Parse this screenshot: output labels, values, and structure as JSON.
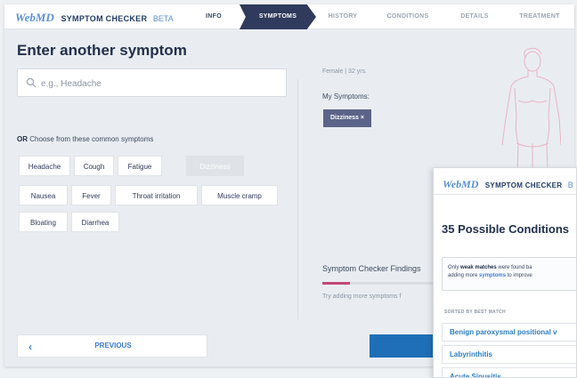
{
  "header": {
    "logo_web": "WebMD",
    "logo_sc": "SYMPTOM CHECKER",
    "logo_beta": "BETA",
    "steps": [
      "INFO",
      "SYMPTOMS",
      "HISTORY",
      "CONDITIONS",
      "DETAILS",
      "TREATMENT"
    ],
    "active_step": "SYMPTOMS"
  },
  "left": {
    "title": "Enter another symptom",
    "search_placeholder": "e.g., Headache",
    "choose_or": "OR",
    "choose_text": "Choose from these common symptoms",
    "chips": [
      "Headache",
      "Cough",
      "Fatigue",
      "Dizziness",
      "Nausea",
      "Fever",
      "Throat irritation",
      "Muscle cramp",
      "Bloating",
      "Diarrhea"
    ],
    "selected_chip": "Dizziness",
    "previous_label": "PREVIOUS"
  },
  "right": {
    "meta": "Female  |  32 yrs.",
    "my_symptoms_label": "My Symptoms:",
    "symptom_chip": "Dizziness  ×",
    "findings_label": "Symptom Checker Findings",
    "findings_progress": 0.25,
    "try_text": "Try adding more symptoms f",
    "accent": "#c2487a"
  },
  "overlay": {
    "logo_web": "WebMD",
    "logo_sc": "SYMPTOM CHECKER",
    "logo_beta": "B",
    "title": "35 Possible Conditions",
    "notice_1": "Only",
    "notice_weak": "weak matches",
    "notice_2": "were found ba",
    "notice_3": "adding more",
    "notice_symptoms": "symptoms",
    "notice_4": "to improve",
    "sorted_label": "SORTED BY BEST MATCH",
    "conditions": [
      "Benign paroxysmal positional v",
      "Labyrinthitis",
      "Acute Sinusitis"
    ]
  },
  "colors": {
    "brand_navy": "#2f3a5c",
    "link_blue": "#2b7dc2",
    "chip_purple": "#5b6488"
  }
}
